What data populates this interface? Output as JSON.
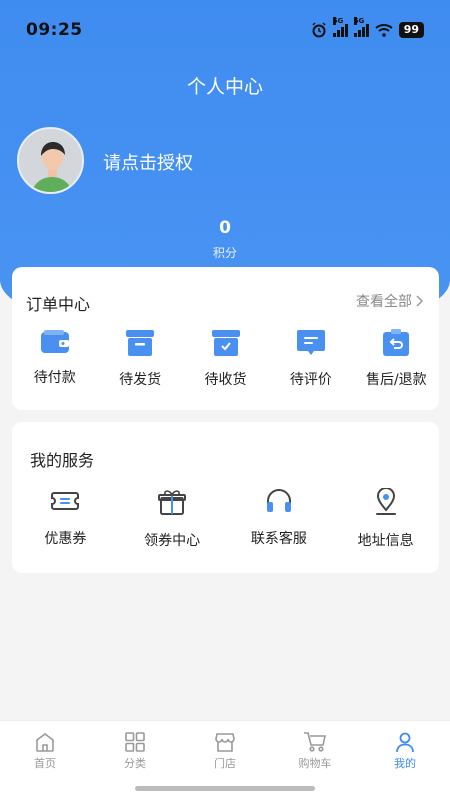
{
  "status_bar": {
    "time": "09:25",
    "network_1": "5G",
    "network_2": "5G",
    "battery": "99"
  },
  "header": {
    "title": "个人中心",
    "auth_text": "请点击授权",
    "points_value": "0",
    "points_label": "积分"
  },
  "order_center": {
    "title": "订单中心",
    "view_all": "查看全部",
    "items": [
      {
        "label": "待付款",
        "icon": "wallet-icon"
      },
      {
        "label": "待发货",
        "icon": "box-icon"
      },
      {
        "label": "待收货",
        "icon": "receive-box-icon"
      },
      {
        "label": "待评价",
        "icon": "comment-icon"
      },
      {
        "label": "售后/退款",
        "icon": "refund-icon"
      }
    ]
  },
  "services": {
    "title": "我的服务",
    "items": [
      {
        "label": "优惠券",
        "icon": "coupon-icon"
      },
      {
        "label": "领券中心",
        "icon": "gift-icon"
      },
      {
        "label": "联系客服",
        "icon": "headphone-icon"
      },
      {
        "label": "地址信息",
        "icon": "location-icon"
      }
    ]
  },
  "tabbar": {
    "items": [
      {
        "label": "首页",
        "icon": "home-icon"
      },
      {
        "label": "分类",
        "icon": "category-icon"
      },
      {
        "label": "门店",
        "icon": "store-icon"
      },
      {
        "label": "购物车",
        "icon": "cart-icon"
      },
      {
        "label": "我的",
        "icon": "user-icon"
      }
    ],
    "active_index": 4
  },
  "colors": {
    "primary": "#3f8cf0",
    "icon_blue": "#4a90f0",
    "background": "#f4f4f4"
  }
}
